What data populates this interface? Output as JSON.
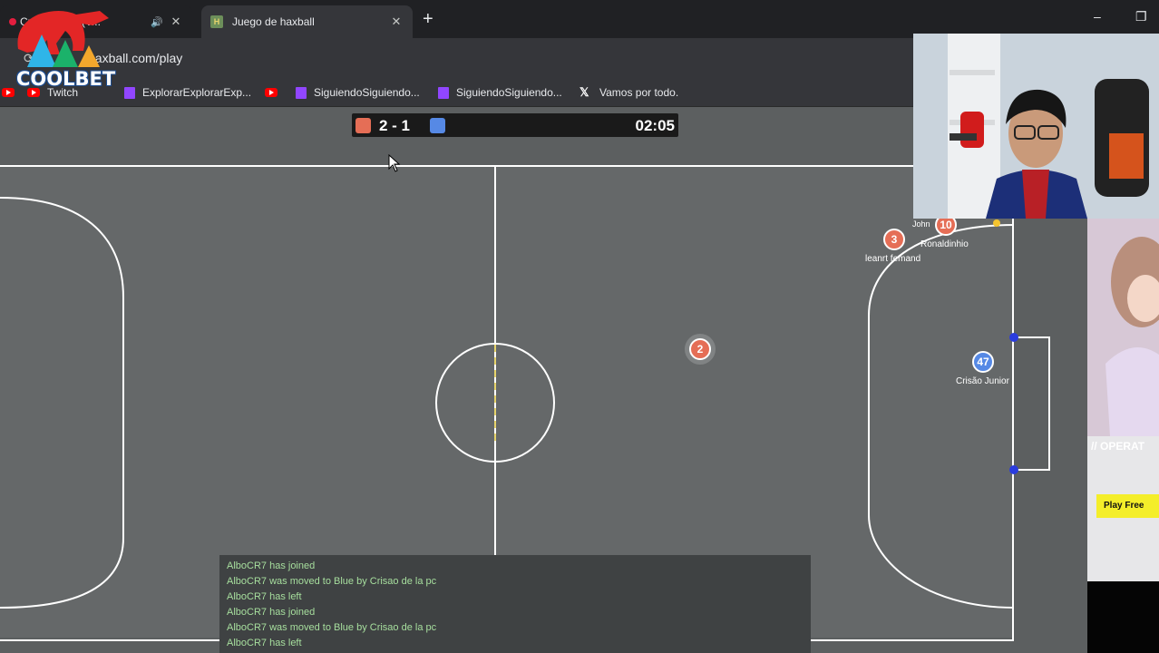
{
  "browser": {
    "tabs": [
      {
        "title": "Cris... home (V...",
        "active": false
      },
      {
        "title": "Juego de haxball",
        "active": true
      }
    ],
    "new_tab": "+",
    "url": "haxball.com/play",
    "bookmarks": [
      {
        "label": "",
        "icon": "youtube-icon"
      },
      {
        "label": "Twitch",
        "icon": "youtube-icon"
      },
      {
        "label": "ExplorarExplorarExp...",
        "icon": "twitch-icon"
      },
      {
        "label": "SiguiendoSiguiendo...",
        "icon": "youtube-icon"
      },
      {
        "label": "SiguiendoSiguiendo...",
        "icon": "twitch-icon"
      },
      {
        "label": "Vamos por todo.",
        "icon": "x-icon"
      }
    ],
    "window_controls": {
      "minimize": "–",
      "restore": "❐"
    }
  },
  "overlay": {
    "logo_text": "COOLBET",
    "ad_text": "// OPERAT",
    "ad_button": "Play Free"
  },
  "game": {
    "score": "2 - 1",
    "time": "02:05",
    "colors": {
      "red_team": "#e56e56",
      "blue_team": "#5689e5",
      "pitch": "#5c5f60",
      "lines": "#ffffff",
      "chat_text": "#a7df9e"
    },
    "players": [
      {
        "number": "3",
        "team": "red",
        "name": "leanrt femand"
      },
      {
        "number": "10",
        "team": "red",
        "name": "Ronaldinhio"
      },
      {
        "number": "",
        "team": "red",
        "name": "John"
      },
      {
        "number": "2",
        "team": "red",
        "name": ""
      },
      {
        "number": "47",
        "team": "blue",
        "name": "Crisão Junior"
      }
    ],
    "chat": [
      "AlboCR7 has joined",
      "AlboCR7 was moved to Blue by Crisao de la pc",
      "AlboCR7 has left",
      "AlboCR7 has joined",
      "AlboCR7 was moved to Blue by Crisao de la pc",
      "AlboCR7 has left"
    ]
  }
}
